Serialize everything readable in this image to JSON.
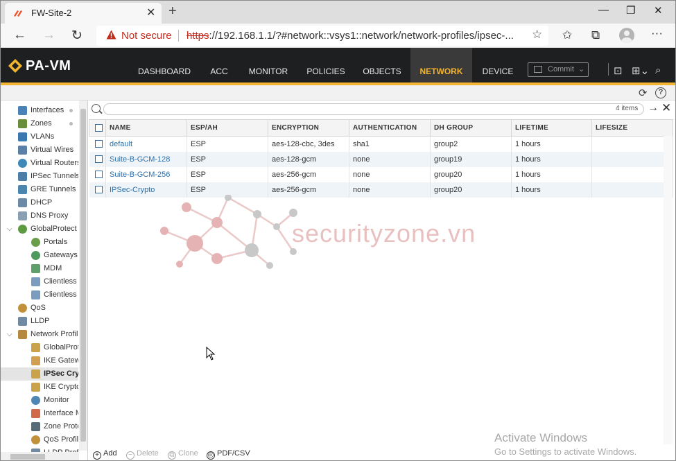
{
  "browser": {
    "tab_title": "FW-Site-2",
    "security_warning": "Not secure",
    "url_scheme": "https",
    "url_rest": "://192.168.1.1/?#network::vsys1::network/network-profiles/ipsec-..."
  },
  "app": {
    "logo": "PA-VM",
    "nav": [
      "DASHBOARD",
      "ACC",
      "MONITOR",
      "POLICIES",
      "OBJECTS",
      "NETWORK",
      "DEVICE"
    ],
    "active_nav": "NETWORK",
    "commit_label": "Commit",
    "accent_color": "#f3b52f"
  },
  "sidebar": {
    "items": [
      {
        "label": "Interfaces",
        "icon": "interfaces-icon"
      },
      {
        "label": "Zones",
        "icon": "zones-icon"
      },
      {
        "label": "VLANs",
        "icon": "vlans-icon"
      },
      {
        "label": "Virtual Wires",
        "icon": "virtual-wires-icon"
      },
      {
        "label": "Virtual Routers",
        "icon": "virtual-routers-icon"
      },
      {
        "label": "IPSec Tunnels",
        "icon": "ipsec-tunnels-icon"
      },
      {
        "label": "GRE Tunnels",
        "icon": "gre-tunnels-icon"
      },
      {
        "label": "DHCP",
        "icon": "dhcp-icon"
      },
      {
        "label": "DNS Proxy",
        "icon": "dns-proxy-icon"
      },
      {
        "label": "GlobalProtect",
        "icon": "globalprotect-icon"
      },
      {
        "label": "Portals",
        "icon": "portals-icon"
      },
      {
        "label": "Gateways",
        "icon": "gateways-icon"
      },
      {
        "label": "MDM",
        "icon": "mdm-icon"
      },
      {
        "label": "Clientless Apps",
        "icon": "clientless-apps-icon"
      },
      {
        "label": "Clientless App Groups",
        "icon": "clientless-app-groups-icon"
      },
      {
        "label": "QoS",
        "icon": "qos-icon"
      },
      {
        "label": "LLDP",
        "icon": "lldp-icon"
      },
      {
        "label": "Network Profiles",
        "icon": "network-profiles-icon"
      },
      {
        "label": "GlobalProtect IPSec Crypto",
        "icon": "gp-ipsec-crypto-icon"
      },
      {
        "label": "IKE Gateways",
        "icon": "ike-gateways-icon"
      },
      {
        "label": "IPSec Crypto",
        "icon": "ipsec-crypto-icon"
      },
      {
        "label": "IKE Crypto",
        "icon": "ike-crypto-icon"
      },
      {
        "label": "Monitor",
        "icon": "monitor-icon"
      },
      {
        "label": "Interface Mgmt",
        "icon": "interface-mgmt-icon"
      },
      {
        "label": "Zone Protection",
        "icon": "zone-protection-icon"
      },
      {
        "label": "QoS Profile",
        "icon": "qos-profile-icon"
      },
      {
        "label": "LLDP Profile",
        "icon": "lldp-profile-icon"
      }
    ],
    "selected": "IPSec Crypto"
  },
  "search": {
    "placeholder": "",
    "count": "4 items"
  },
  "table": {
    "columns": [
      "NAME",
      "ESP/AH",
      "ENCRYPTION",
      "AUTHENTICATION",
      "DH GROUP",
      "LIFETIME",
      "LIFESIZE"
    ],
    "rows": [
      {
        "name": "default",
        "esp_ah": "ESP",
        "encryption": "aes-128-cbc, 3des",
        "authentication": "sha1",
        "dh_group": "group2",
        "lifetime": "1 hours",
        "lifesize": ""
      },
      {
        "name": "Suite-B-GCM-128",
        "esp_ah": "ESP",
        "encryption": "aes-128-gcm",
        "authentication": "none",
        "dh_group": "group19",
        "lifetime": "1 hours",
        "lifesize": ""
      },
      {
        "name": "Suite-B-GCM-256",
        "esp_ah": "ESP",
        "encryption": "aes-256-gcm",
        "authentication": "none",
        "dh_group": "group20",
        "lifetime": "1 hours",
        "lifesize": ""
      },
      {
        "name": "IPSec-Crypto",
        "esp_ah": "ESP",
        "encryption": "aes-256-gcm",
        "authentication": "none",
        "dh_group": "group20",
        "lifetime": "1 hours",
        "lifesize": ""
      }
    ]
  },
  "footer": {
    "add": "Add",
    "delete": "Delete",
    "clone": "Clone",
    "pdf_csv": "PDF/CSV"
  },
  "watermark": {
    "text": "securityzone.vn"
  },
  "activation": {
    "title": "Activate Windows",
    "subtitle": "Go to Settings to activate Windows."
  }
}
